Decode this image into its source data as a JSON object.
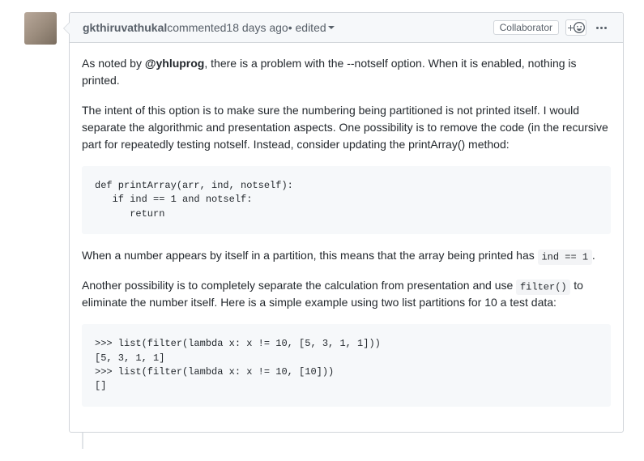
{
  "header": {
    "author": "gkthiruvathukal",
    "action": " commented ",
    "timestamp": "18 days ago",
    "edited_label": " • edited",
    "badge": "Collaborator"
  },
  "body": {
    "p1_pre": "As noted by ",
    "p1_mention": "@yhluprog",
    "p1_post": ", there is a problem with the --notself option. When it is enabled, nothing is printed.",
    "p2": "The intent of this option is to make sure the numbering being partitioned is not printed itself. I would separate the algorithmic and presentation aspects. One possibility is to remove the code (in the recursive part for repeatedly testing notself. Instead, consider updating the printArray() method:",
    "code1": "def printArray(arr, ind, notself):\n   if ind == 1 and notself:\n      return",
    "p3_pre": "When a number appears by itself in a partition, this means that the array being printed has ",
    "p3_code": "ind == 1",
    "p3_post": ".",
    "p4_pre": "Another possibility is to completely separate the calculation from presentation and use ",
    "p4_code": "filter()",
    "p4_post": " to eliminate the number itself. Here is a simple example using two list partitions for 10 a test data:",
    "code2": ">>> list(filter(lambda x: x != 10, [5, 3, 1, 1]))\n[5, 3, 1, 1]\n>>> list(filter(lambda x: x != 10, [10]))\n[]"
  }
}
